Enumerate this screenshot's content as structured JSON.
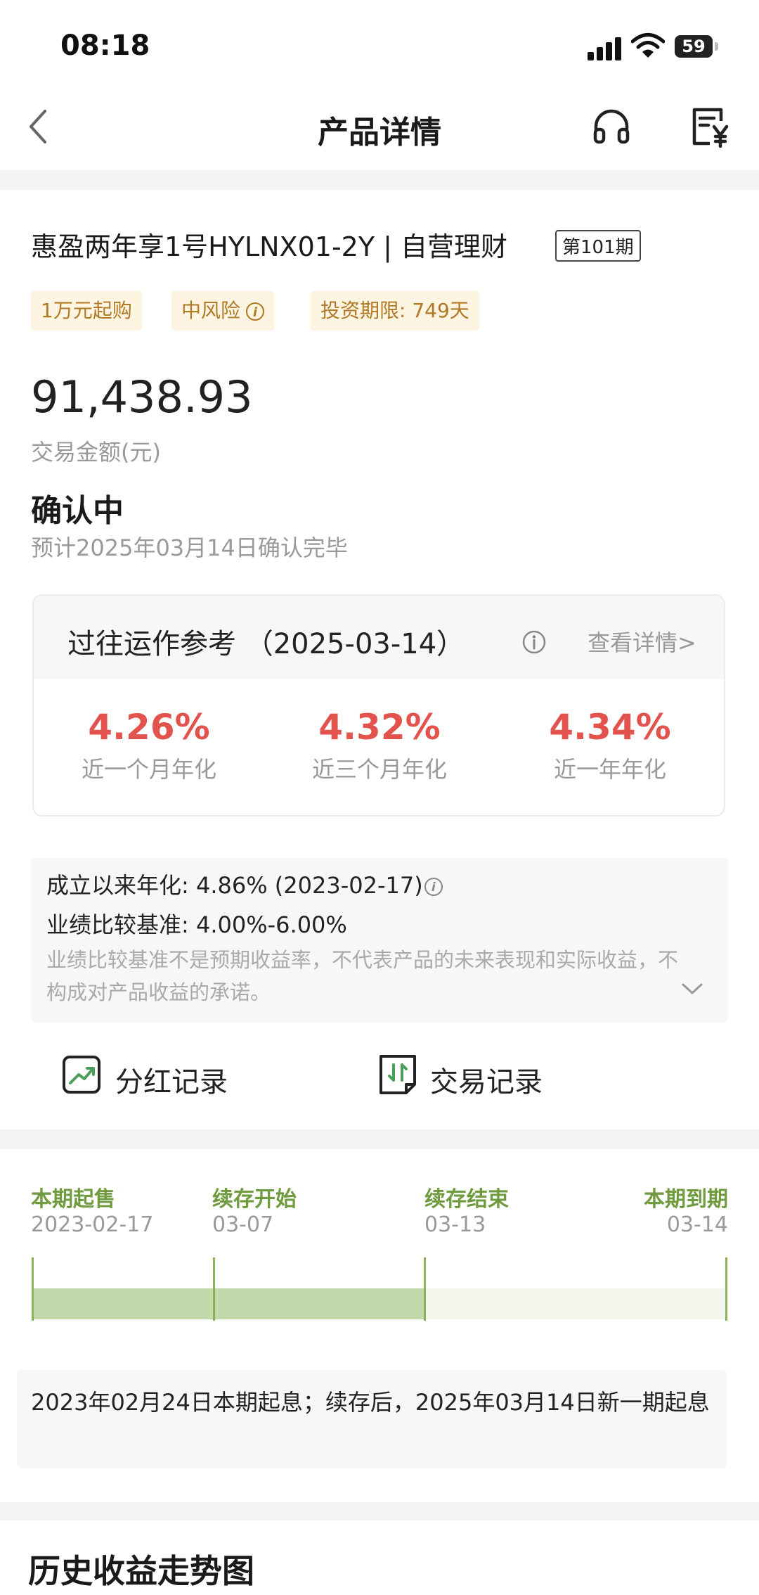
{
  "status_bar": {
    "time": "08:18",
    "battery": "59"
  },
  "nav": {
    "title": "产品详情"
  },
  "product": {
    "name": "惠盈两年享1号HYLNX01-2Y | 自营理财",
    "period": "第101期",
    "tags": [
      "1万元起购",
      "中风险",
      "投资期限: 749天"
    ],
    "amount": "91,438.93",
    "amount_label": "交易金额(元)",
    "status": "确认中",
    "status_sub": "预计2025年03月14日确认完毕"
  },
  "performance": {
    "title": "过往运作参考 （2025-03-14）",
    "link": "查看详情>",
    "rates": [
      {
        "value": "4.26%",
        "label": "近一个月年化"
      },
      {
        "value": "4.32%",
        "label": "近三个月年化"
      },
      {
        "value": "4.34%",
        "label": "近一年年化"
      }
    ]
  },
  "info": {
    "since": "成立以来年化: 4.86% (2023-02-17)",
    "benchmark": "业绩比较基准: 4.00%-6.00%",
    "disclaimer": "业绩比较基准不是预期收益率，不代表产品的未来表现和实际收益，不构成对产品收益的承诺。"
  },
  "records": {
    "dividend": "分红记录",
    "trade": "交易记录"
  },
  "timeline": {
    "milestones": [
      {
        "name": "本期起售",
        "date": "2023-02-17"
      },
      {
        "name": "续存开始",
        "date": "03-07"
      },
      {
        "name": "续存结束",
        "date": "03-13"
      },
      {
        "name": "本期到期",
        "date": "03-14"
      }
    ],
    "note": "2023年02月24日本期起息；续存后，2025年03月14日新一期起息"
  },
  "chart_section": {
    "title": "历史收益走势图"
  },
  "colors": {
    "accent_red": "#e2534d",
    "timeline_green": "#6f9a3d",
    "tag_text": "#b07925"
  }
}
